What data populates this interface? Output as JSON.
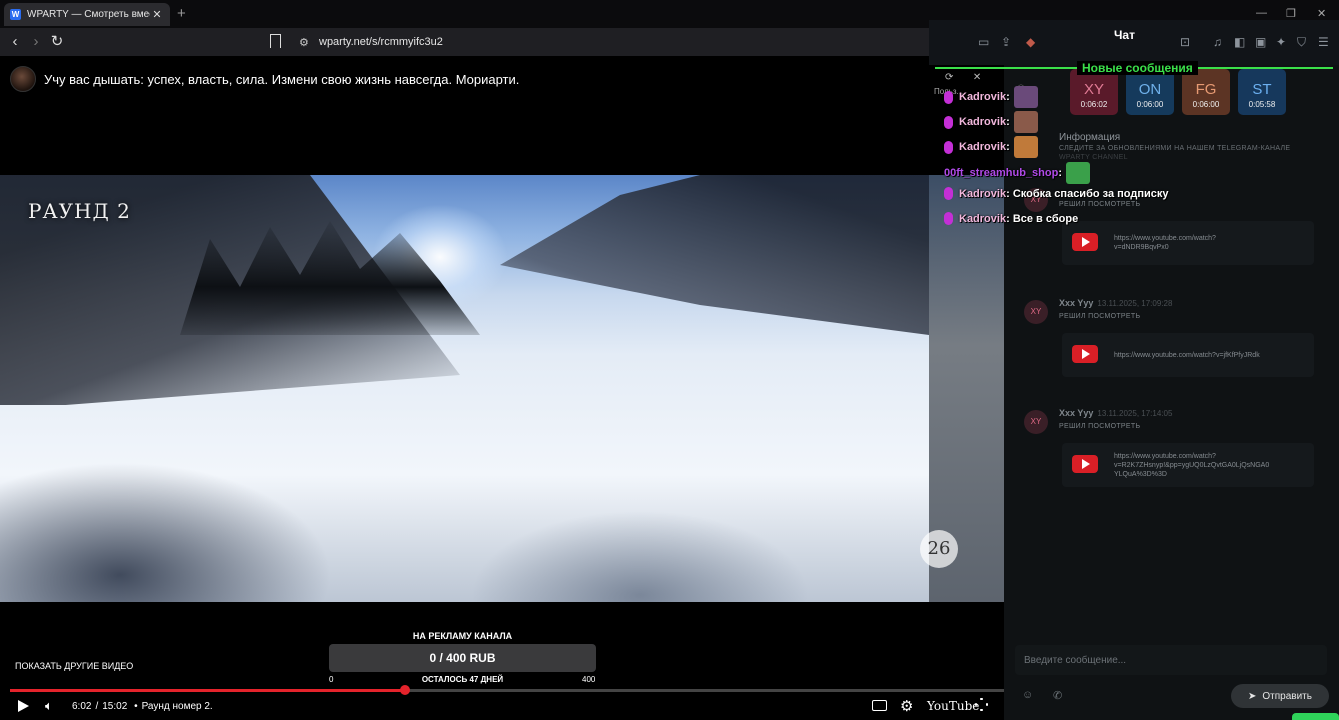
{
  "browser": {
    "tab_title": "WPARTY — Смотреть вместе",
    "tab_favicon": "wparty-icon",
    "tab_close": "✕",
    "new_tab": "+",
    "url": "wparty.net/s/rcmmyifc3u2"
  },
  "page": {
    "video_title": "Учу вас дышать: успех, власть, сила. Измени свою жизнь навсегда. Мориарти.",
    "round_overlay": "РАУНД 2",
    "watermark": "26",
    "show_other_videos": "ПОКАЗАТЬ ДРУГИЕ ВИДЕО"
  },
  "ad_goal": {
    "label": "НА РЕКЛАМУ КАНАЛА",
    "amount": "0 / 400 RUB",
    "min": "0",
    "remaining": "ОСТАЛОСЬ 47 ДНЕЙ",
    "max": "400",
    "progress_fraction": 0.0
  },
  "player": {
    "current_time": "6:02",
    "duration": "15:02",
    "separator": "/",
    "bullet": "•",
    "chapter": "Раунд номер 2.",
    "progress_fraction": 0.382,
    "youtube_label": "YouTube"
  },
  "chat": {
    "title": "Чат",
    "new_messages": "Новые сообщения",
    "users": [
      {
        "initials": "XY",
        "time": "0:06:02",
        "color": "#5a1a2a",
        "text": "#e07a94"
      },
      {
        "initials": "ON",
        "time": "0:06:00",
        "color": "#153a5c",
        "text": "#6fb0ea"
      },
      {
        "initials": "FG",
        "time": "0:06:00",
        "color": "#5c3424",
        "text": "#e69a73"
      },
      {
        "initials": "ST",
        "time": "0:05:58",
        "color": "#16385c",
        "text": "#6cb0f0"
      }
    ],
    "info": {
      "title": "Информация",
      "subtitle": "СЛЕДИТЕ ЗА ОБНОВЛЕНИЯМИ НА НАШЕМ TELEGRAM-КАНАЛЕ",
      "subtitle2": "WPARTY CHANNEL"
    },
    "messages": [
      {
        "initials": "XY",
        "author": "",
        "date": "",
        "label": "РЕШИЛ ПОСМОТРЕТЬ",
        "url": "https://www.youtube.com/watch?\nv=dNDR9BqvPx0"
      },
      {
        "initials": "XY",
        "author": "Xxx Yyy",
        "date": "13.11.2025, 17:09:28",
        "label": "РЕШИЛ ПОСМОТРЕТЬ",
        "url": "https://www.youtube.com/watch?v=jfKfPfyJRdk"
      },
      {
        "initials": "XY",
        "author": "Xxx Yyy",
        "date": "13.11.2025, 17:14:05",
        "label": "РЕШИЛ ПОСМОТРЕТЬ",
        "url": "https://www.youtube.com/watch?\nv=R2K7ZHsnyp!&pp=ygUQ0LzQvtGA0LjQsNGA0\nYLQuA%3D%3D"
      }
    ],
    "input_placeholder": "Введите сообщение...",
    "send_label": "Отправить"
  },
  "overlay_chat": {
    "tool_label": "Польз...",
    "rows": [
      {
        "author": "Kadrovik",
        "text": "",
        "emote": "#6a4a7a"
      },
      {
        "author": "Kadrovik",
        "text": "",
        "emote": "#8a5a4a"
      },
      {
        "author": "Kadrovik",
        "text": "",
        "emote": "#c07a3a"
      },
      {
        "author": "00ft_streamhub_shop",
        "text": "",
        "emote": "#3aa04a"
      },
      {
        "author": "Kadrovik",
        "text": "Скобка спасибо за подписку",
        "emote": ""
      },
      {
        "author": "Kadrovik",
        "text": "Все в сборе",
        "emote": ""
      }
    ]
  }
}
